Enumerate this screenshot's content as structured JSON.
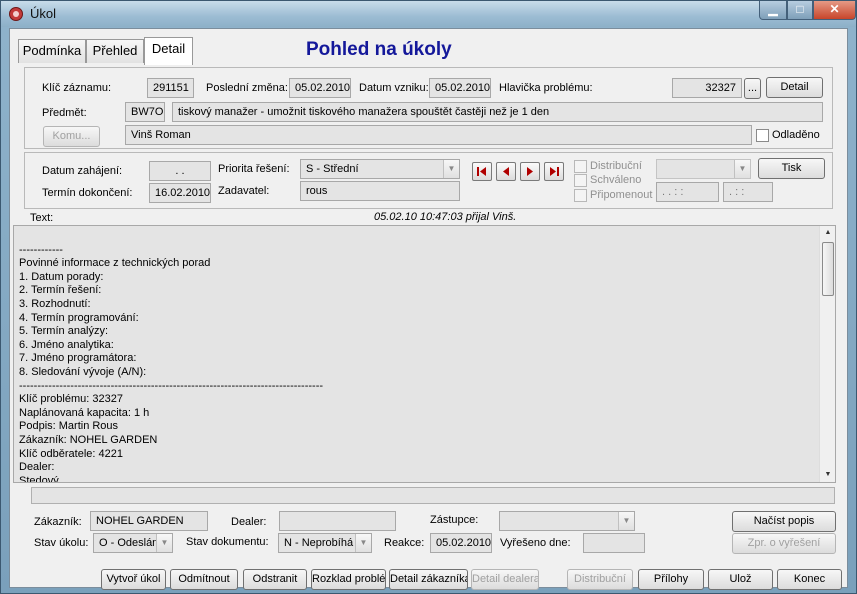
{
  "window": {
    "title": "Úkol",
    "min": "▁",
    "max": "□",
    "close": "✕"
  },
  "tabs": [
    {
      "label": "Podmínka"
    },
    {
      "label": "Přehled"
    },
    {
      "label": "Detail"
    }
  ],
  "heading": "Pohled na úkoly",
  "record": {
    "key_label": "Klíč záznamu:",
    "key_value": "291151",
    "last_change_label": "Poslední změna:",
    "last_change_value": "05.02.2010",
    "created_label": "Datum vzniku:",
    "created_value": "05.02.2010",
    "problem_header_label": "Hlavička problému:",
    "problem_header_value": "32327",
    "ellipsis_button": "...",
    "detail_button": "Detail",
    "subject_label": "Předmět:",
    "subject_code": "BW7O",
    "subject_text": "tiskový manažer - umožnit tiskového manažera spouštět častěji než je 1 den",
    "to_button": "Komu...",
    "to_value": "Vinš Roman",
    "postponed_label": "Odladěno"
  },
  "schedule": {
    "start_label": "Datum zahájení:",
    "start_value": " .  .",
    "finish_label": "Termín dokončení:",
    "finish_value": "16.02.2010",
    "priority_label": "Priorita řešení:",
    "priority_value": "S - Střední",
    "submitter_label": "Zadavatel:",
    "submitter_value": "rous",
    "distribution_label": "Distribuční",
    "approved_label": "Schváleno",
    "remind_label": "Připomenout",
    "remind_date": " .  .     :  :",
    "remind_time": " .     :  :",
    "print_button": "Tisk"
  },
  "text": {
    "label": "Text:",
    "stamp": "05.02.10 10:47:03 přijal Vinš.",
    "lines": [
      "",
      "------------",
      "Povinné informace z technických porad",
      "1. Datum porady:",
      "2. Termín řešení:",
      "3. Rozhodnutí:",
      "4. Termín programování:",
      "5. Termín analýzy:",
      "6. Jméno analytika:",
      "7. Jméno programátora:",
      "8. Sledování vývoje (A/N):",
      "-----------------------------------------------------------------------------------",
      "Klíč problému: 32327",
      "Naplánovaná kapacita: 1 h",
      "Podpis: Martin Rous",
      "Zákazník: NOHEL GARDEN",
      "Klíč odběratele: 4221",
      "Dealer:",
      "Stedový"
    ]
  },
  "bottom": {
    "customer_label": "Zákazník:",
    "customer_value": "NOHEL GARDEN",
    "dealer_label": "Dealer:",
    "dealer_value": "",
    "deputy_label": "Zástupce:",
    "deputy_value": "",
    "load_desc_button": "Načíst popis",
    "task_state_label": "Stav úkolu:",
    "task_state_value": "O - Odeslán",
    "doc_state_label": "Stav dokumentu:",
    "doc_state_value": "N - Neprobíhá",
    "reaction_label": "Reakce:",
    "reaction_value": "05.02.2010",
    "resolved_label": "Vyřešeno dne:",
    "resolved_value": "",
    "resolution_msg_button": "Zpr. o vyřešení"
  },
  "footer": {
    "create_task": "Vytvoř úkol",
    "reject": "Odmítnout",
    "delete": "Odstranit",
    "breakdown": "Rozklad problém",
    "customer_detail": "Detail zákazníka",
    "dealer_detail": "Detail dealera",
    "distribution": "Distribuční",
    "attachments": "Přílohy",
    "save": "Ulož",
    "end": "Konec"
  }
}
